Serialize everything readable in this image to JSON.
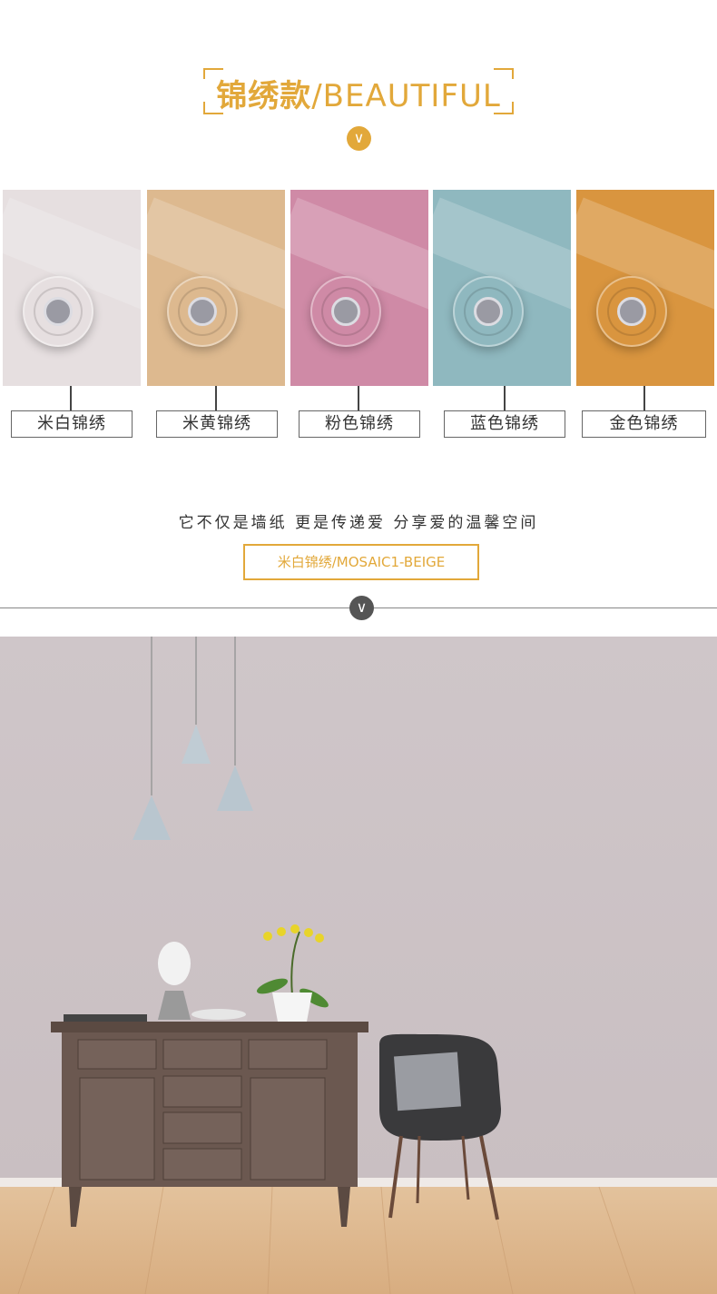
{
  "header": {
    "title_cn": "锦绣款",
    "title_en": "/BEAUTIFUL",
    "accent_color": "#e2a83a",
    "chevron_icon": "chevron-down-icon"
  },
  "swatches": [
    {
      "label": "米白锦绣",
      "color": "#e6dfe0"
    },
    {
      "label": "米黄锦绣",
      "color": "#ddb98f"
    },
    {
      "label": "粉色锦绣",
      "color": "#cf8aa6"
    },
    {
      "label": "蓝色锦绣",
      "color": "#8fb8bf"
    },
    {
      "label": "金色锦绣",
      "color": "#d9953f"
    }
  ],
  "slogan": "它不仅是墙纸 更是传递爱 分享爱的温馨空间",
  "model_tag": "米白锦绣/MOSAIC1-BEIGE",
  "divider_chevron_icon": "chevron-down-icon"
}
